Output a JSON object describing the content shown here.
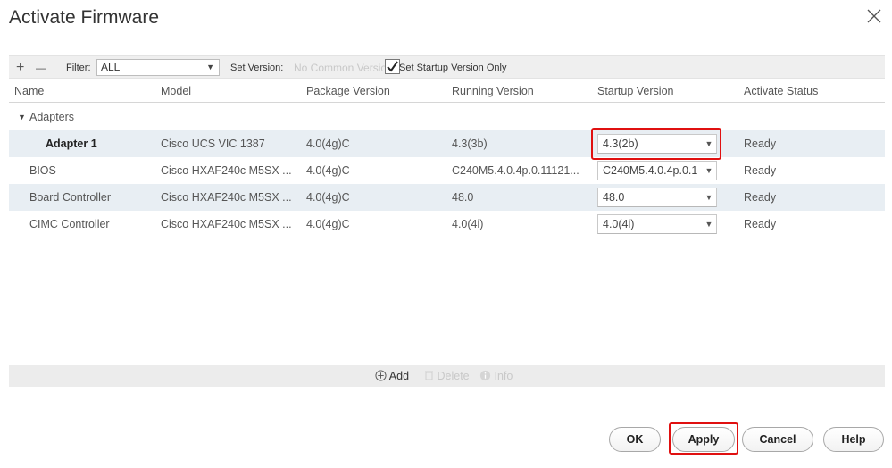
{
  "dialog": {
    "title": "Activate Firmware"
  },
  "toolbar": {
    "add_symbol": "+",
    "remove_symbol": "—",
    "filter_label": "Filter:",
    "filter_value": "ALL",
    "set_version_label": "Set Version:",
    "set_version_value": "No Common Version",
    "startup_only_label": "Set Startup Version Only",
    "startup_only_checked": true
  },
  "columns": [
    "Name",
    "Model",
    "Package Version",
    "Running Version",
    "Startup Version",
    "Activate Status"
  ],
  "group": {
    "label": "Adapters",
    "expanded": true
  },
  "rows": [
    {
      "name": "Adapter 1",
      "model": "Cisco UCS VIC 1387",
      "package": "4.0(4g)C",
      "running": "4.3(3b)",
      "startup": "4.3(2b)",
      "status": "Ready"
    },
    {
      "name": "BIOS",
      "model": "Cisco HXAF240c M5SX ...",
      "package": "4.0(4g)C",
      "running": "C240M5.4.0.4p.0.11121...",
      "startup": "C240M5.4.0.4p.0.1",
      "status": "Ready"
    },
    {
      "name": "Board Controller",
      "model": "Cisco HXAF240c M5SX ...",
      "package": "4.0(4g)C",
      "running": "48.0",
      "startup": "48.0",
      "status": "Ready"
    },
    {
      "name": "CIMC Controller",
      "model": "Cisco HXAF240c M5SX ...",
      "package": "4.0(4g)C",
      "running": "4.0(4i)",
      "startup": "4.0(4i)",
      "status": "Ready"
    }
  ],
  "bottom_toolbar": {
    "add": "Add",
    "delete": "Delete",
    "info": "Info"
  },
  "buttons": {
    "ok": "OK",
    "apply": "Apply",
    "cancel": "Cancel",
    "help": "Help"
  },
  "colors": {
    "highlight": "#e01010",
    "row_shade": "#e8eef3",
    "toolbar_bg": "#efefef"
  }
}
